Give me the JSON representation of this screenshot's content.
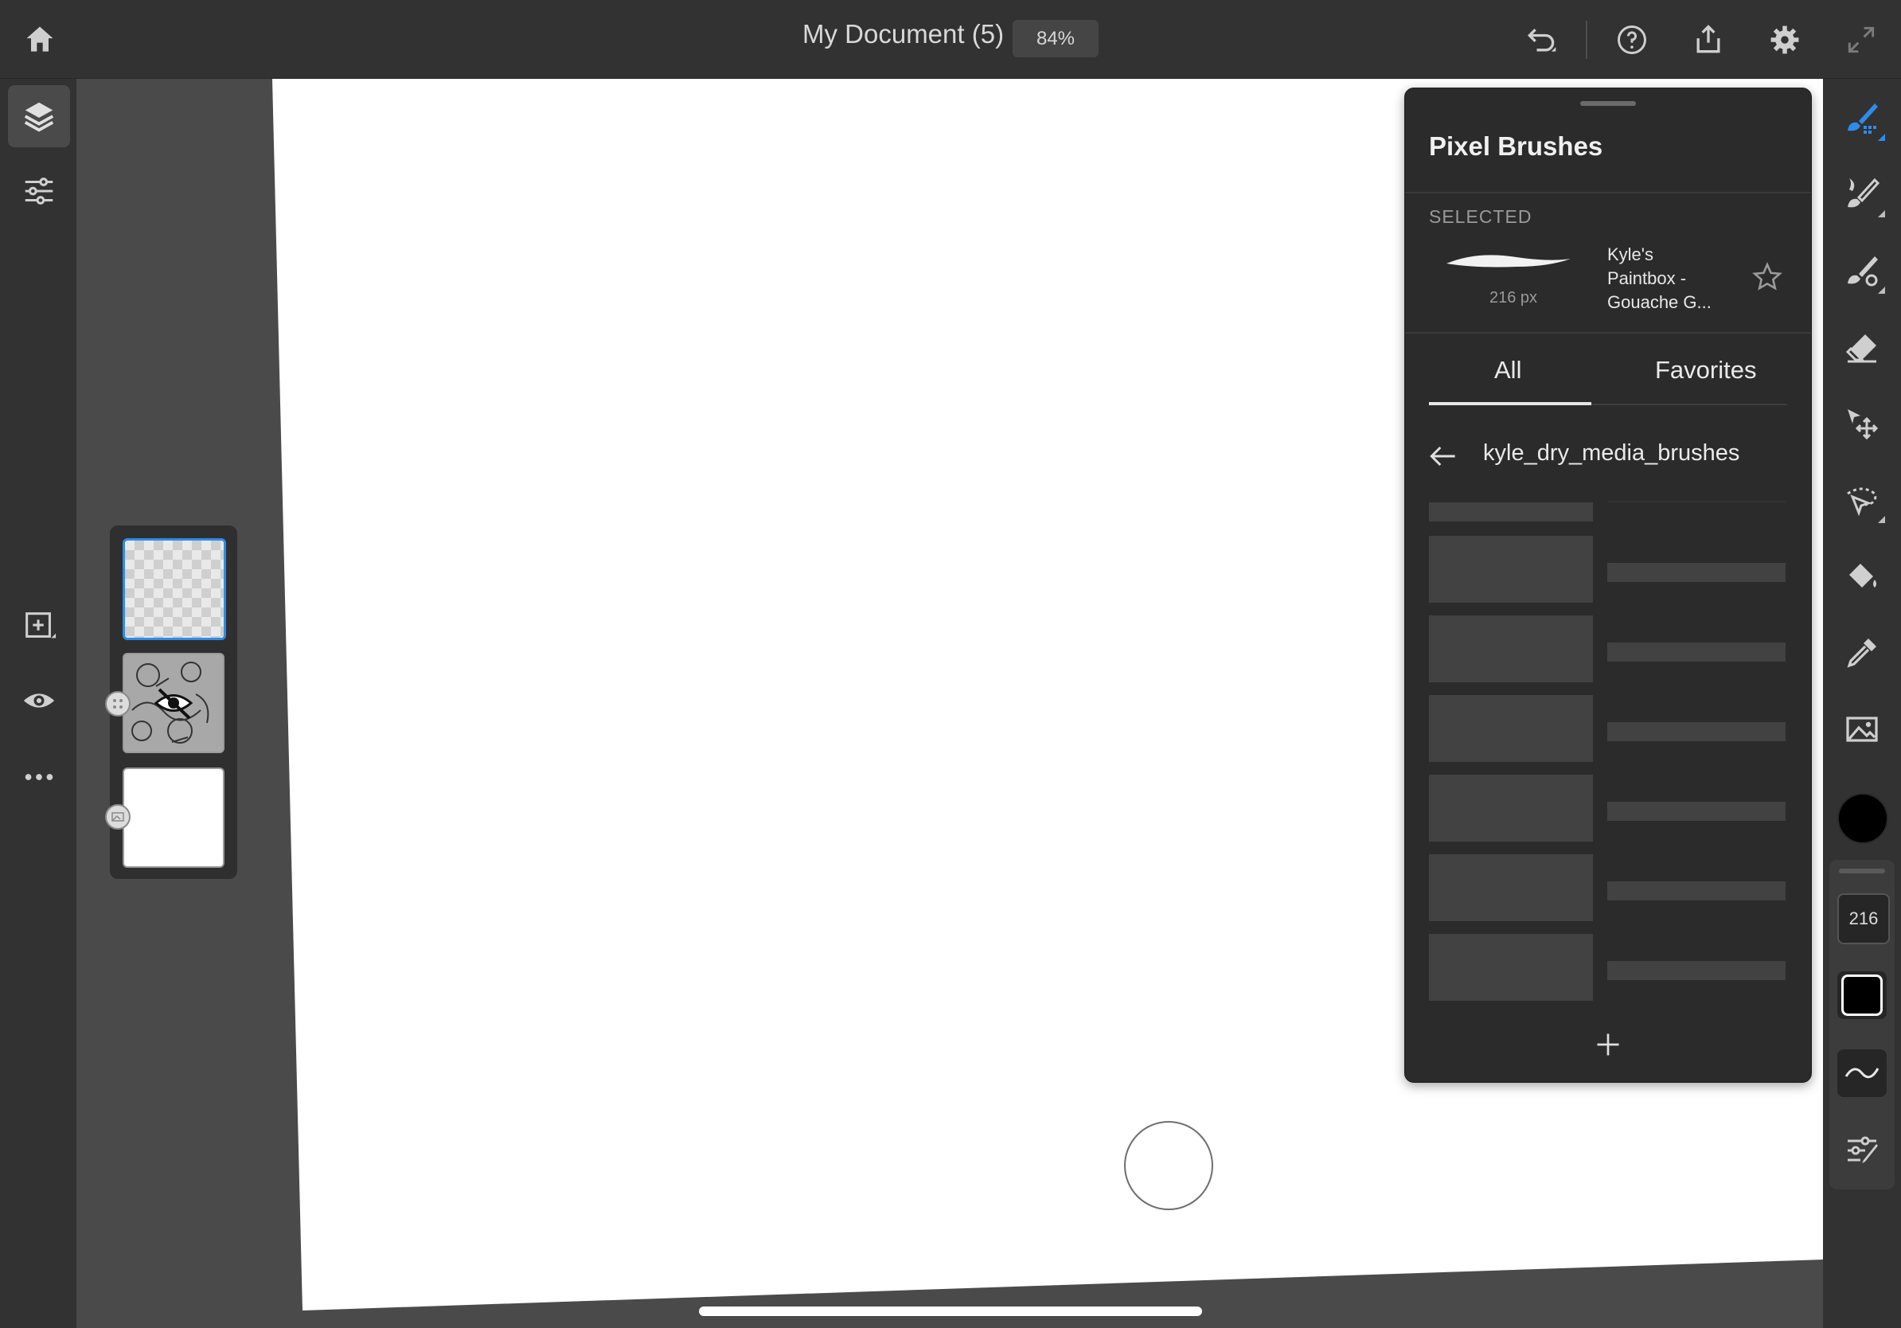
{
  "document": {
    "title": "My Document (5)",
    "zoom": "84%"
  },
  "top_icons": [
    "home-icon",
    "undo-icon",
    "help-icon",
    "share-icon",
    "settings-icon",
    "fullscreen-icon"
  ],
  "left_rail": {
    "items": [
      "layers-icon",
      "layer-properties-icon",
      "add-layer-icon",
      "visibility-icon",
      "more-icon"
    ]
  },
  "brush_panel": {
    "title": "Pixel Brushes",
    "selected_label": "SELECTED",
    "selected_brush": {
      "size": "216 px",
      "name": "Kyle's Paintbox - Gouache G..."
    },
    "tabs": [
      {
        "label": "All",
        "active": true
      },
      {
        "label": "Favorites",
        "active": false
      }
    ],
    "folder": "kyle_dry_media_brushes"
  },
  "tools": [
    "pixel-brush-icon",
    "live-brush-icon",
    "mixer-brush-icon",
    "eraser-icon",
    "transform-icon",
    "selection-icon",
    "fill-icon",
    "eyedropper-icon",
    "image-icon"
  ],
  "brush_settings": {
    "size": "216",
    "color": "#000000"
  },
  "colors": {
    "accent": "#2d8ceb",
    "canvas": "#ffffff",
    "chrome": "#323232"
  }
}
